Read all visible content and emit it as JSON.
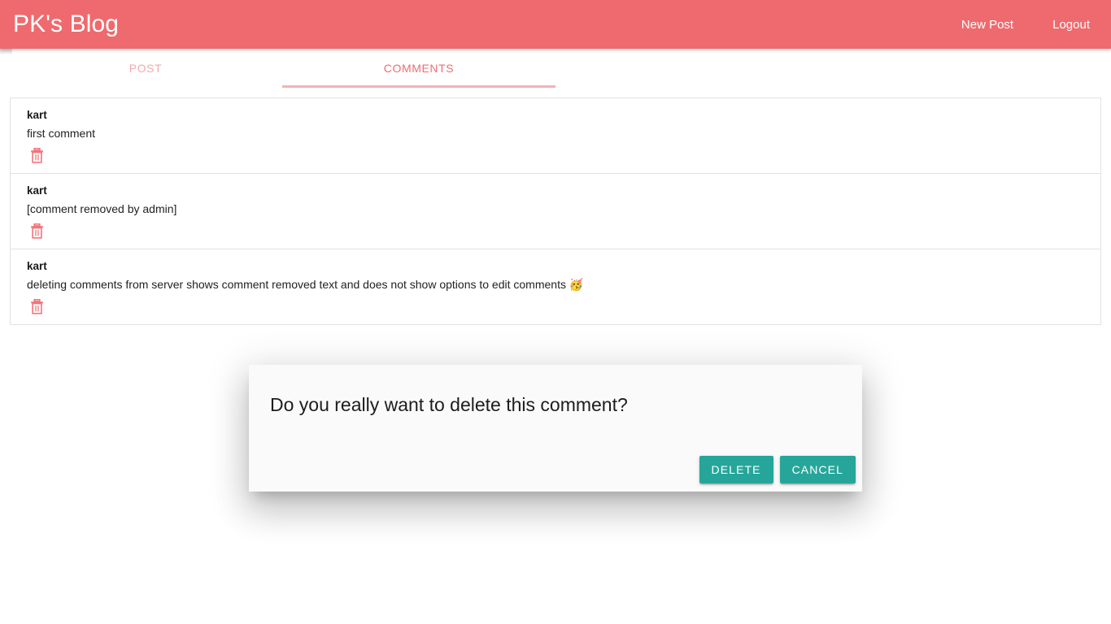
{
  "appbar": {
    "brand": "PK's Blog",
    "nav": [
      {
        "label": "New Post",
        "name": "new-post"
      },
      {
        "label": "Logout",
        "name": "logout"
      }
    ]
  },
  "tabs": [
    {
      "label": "POST",
      "active": false
    },
    {
      "label": "COMMENTS",
      "active": true
    }
  ],
  "comments": [
    {
      "author": "kart",
      "text": "first comment",
      "emoji": "",
      "delete_icon": "trash-icon"
    },
    {
      "author": "kart",
      "text": "[comment removed by admin]",
      "emoji": "",
      "delete_icon": "trash-icon"
    },
    {
      "author": "kart",
      "text": "deleting comments from server shows comment removed text and does not show options to edit comments ",
      "emoji": "🥳",
      "delete_icon": "trash-icon"
    }
  ],
  "dialog": {
    "title": "Do you really want to delete this comment?",
    "confirm_label": "DELETE",
    "cancel_label": "CANCEL"
  },
  "colors": {
    "appbar": "#ee6a6e",
    "tab_active": "#ef6d71",
    "tab_inactive": "#f4a9ac",
    "tab_underline": "#f3b2b4",
    "button": "#26a69a",
    "trash_icon": "#f2757a",
    "dialog_bg": "#fafafa",
    "card_border": "#e2e2e2"
  }
}
